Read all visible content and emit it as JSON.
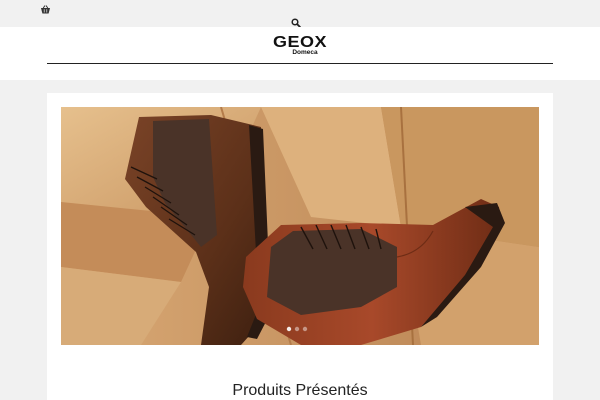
{
  "topbar": {
    "cart_icon": "basket-icon",
    "search_icon": "search-icon"
  },
  "header": {
    "brand": "GEOX",
    "brand_sub": "Domeca"
  },
  "hero": {
    "slides": 3,
    "active_slide": 1
  },
  "featured": {
    "title": "Produits Présentés"
  },
  "colors": {
    "page_bg": "#f1f1f1",
    "card_bg": "#ffffff",
    "wood_light": "#d9b07e",
    "leather_brown": "#6b3a22",
    "leather_red": "#9b3e20",
    "suede": "#4a3328"
  }
}
